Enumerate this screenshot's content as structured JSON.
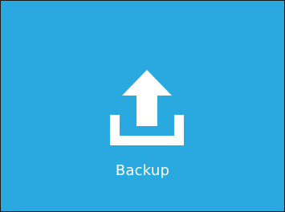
{
  "tile": {
    "label": "Backup",
    "icon": "upload-tray-icon",
    "background_color": "#29a9e0",
    "foreground_color": "#ffffff"
  }
}
